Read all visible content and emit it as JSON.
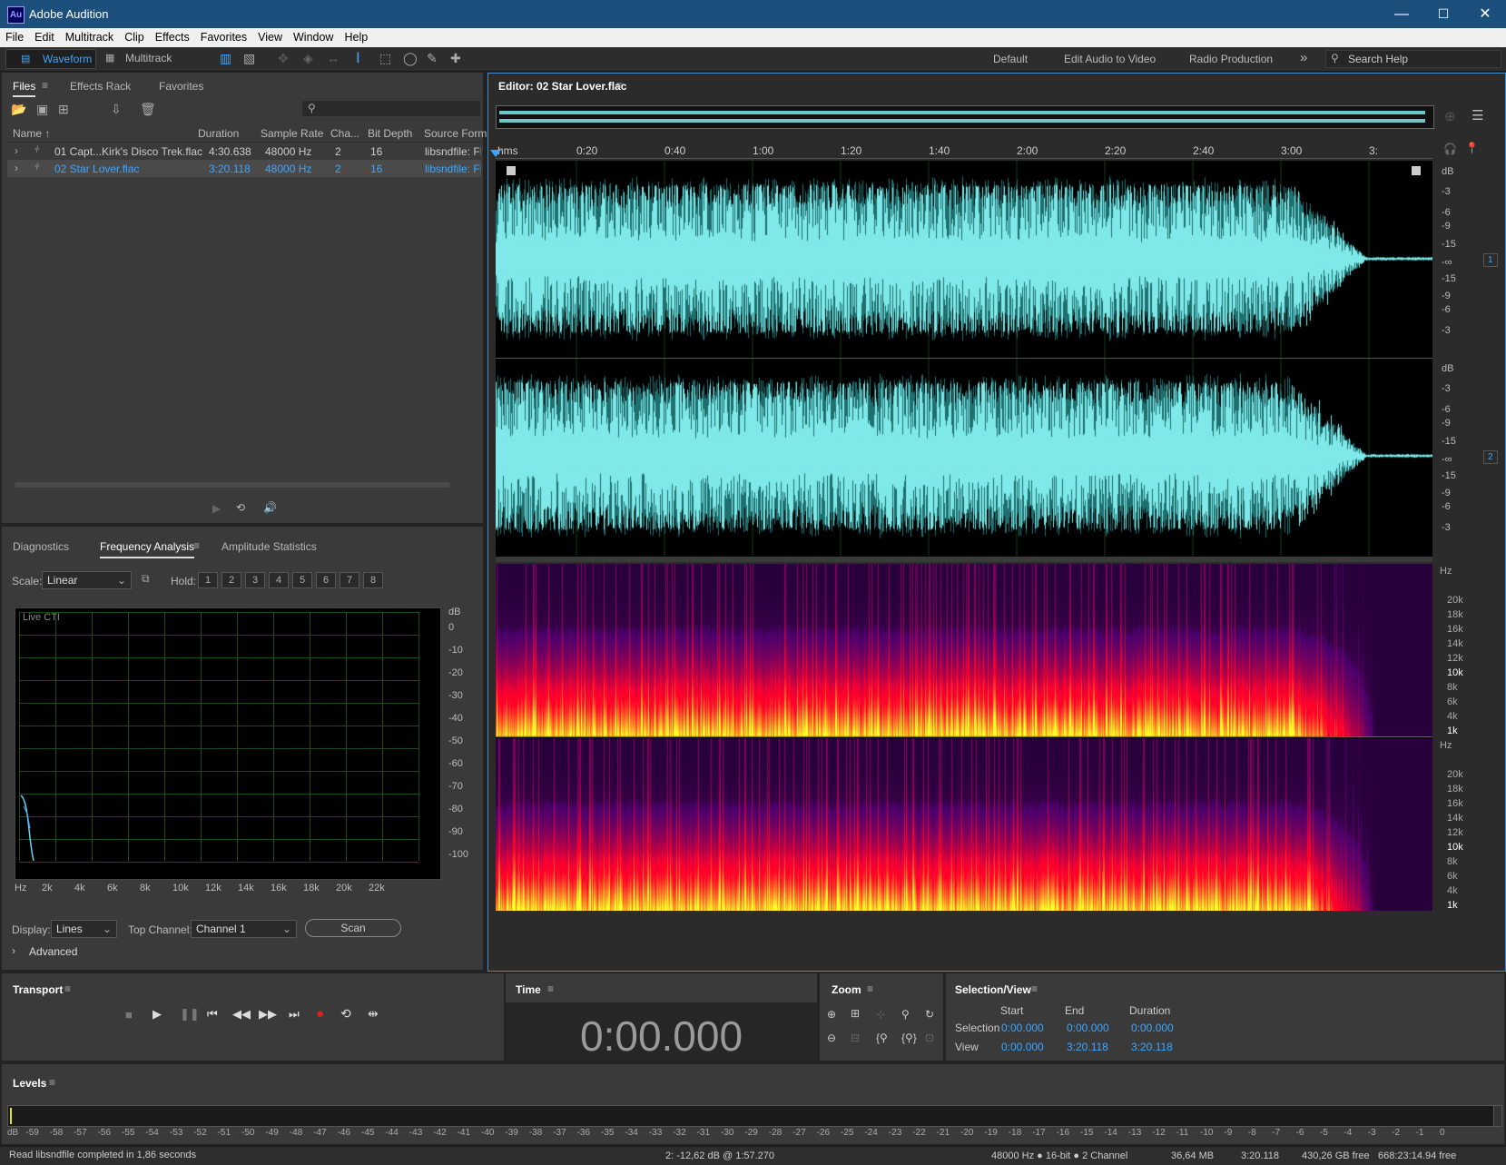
{
  "window": {
    "title": "Adobe Audition",
    "logo": "Au",
    "controls": [
      "—",
      "☐",
      "✕"
    ]
  },
  "menu": [
    "File",
    "Edit",
    "Multitrack",
    "Clip",
    "Effects",
    "Favorites",
    "View",
    "Window",
    "Help"
  ],
  "toolbar": {
    "waveform": "Waveform",
    "multitrack": "Multitrack",
    "workspaces": [
      "Default",
      "Edit Audio to Video",
      "Radio Production"
    ],
    "more": "»",
    "search_placeholder": "Search Help"
  },
  "files_panel": {
    "tabs": [
      "Files",
      "Effects Rack",
      "Favorites"
    ],
    "columns": [
      "Name",
      "Duration",
      "Sample Rate",
      "Cha...",
      "Bit Depth",
      "Source Forma"
    ],
    "rows": [
      {
        "name": "01 Capt...Kirk's Disco Trek.flac",
        "duration": "4:30.638",
        "rate": "48000 Hz",
        "ch": "2",
        "depth": "16",
        "format": "libsndfile: FL",
        "selected": false
      },
      {
        "name": "02 Star Lover.flac",
        "duration": "3:20.118",
        "rate": "48000 Hz",
        "ch": "2",
        "depth": "16",
        "format": "libsndfile: FL",
        "selected": true
      }
    ]
  },
  "freq_panel": {
    "tabs": [
      "Diagnostics",
      "Frequency Analysis",
      "Amplitude Statistics"
    ],
    "scale_label": "Scale:",
    "scale_value": "Linear",
    "hold_label": "Hold:",
    "holds": [
      "1",
      "2",
      "3",
      "4",
      "5",
      "6",
      "7",
      "8"
    ],
    "hold_colors": [
      "#e02020",
      "#ff8c00",
      "#e6e600",
      "#7fd000",
      "#20c040",
      "#00c8d8",
      "#3a7fff",
      "#e020e0"
    ],
    "graph_label": "Live CTI",
    "db_ticks": [
      "dB",
      "0",
      "-10",
      "-20",
      "-30",
      "-40",
      "-50",
      "-60",
      "-70",
      "-80",
      "-90",
      "-100"
    ],
    "hz_ticks": [
      "Hz",
      "2k",
      "4k",
      "6k",
      "8k",
      "10k",
      "12k",
      "14k",
      "16k",
      "18k",
      "20k",
      "22k"
    ],
    "display_label": "Display:",
    "display_value": "Lines",
    "top_channel_label": "Top Channel:",
    "top_channel_value": "Channel 1",
    "scan": "Scan",
    "advanced": "Advanced"
  },
  "editor": {
    "title": "Editor: 02 Star Lover.flac",
    "ruler": [
      "hms",
      "0:20",
      "0:40",
      "1:00",
      "1:20",
      "1:40",
      "2:00",
      "2:20",
      "2:40",
      "3:00",
      "3:"
    ],
    "db_scale": [
      "dB",
      "-3",
      "-6",
      "-9",
      "-15",
      "-∞",
      "-15",
      "-9",
      "-6",
      "-3"
    ],
    "channels": [
      "1",
      "2"
    ],
    "hz_scale": [
      "Hz",
      "20k",
      "18k",
      "16k",
      "14k",
      "12k",
      "10k",
      "8k",
      "6k",
      "4k",
      "1k"
    ]
  },
  "transport": {
    "title": "Transport"
  },
  "time": {
    "title": "Time",
    "value": "0:00.000"
  },
  "zoom": {
    "title": "Zoom"
  },
  "selection": {
    "title": "Selection/View",
    "headers": [
      "Start",
      "End",
      "Duration"
    ],
    "rows": [
      {
        "label": "Selection",
        "start": "0:00.000",
        "end": "0:00.000",
        "duration": "0:00.000"
      },
      {
        "label": "View",
        "start": "0:00.000",
        "end": "3:20.118",
        "duration": "3:20.118"
      }
    ]
  },
  "levels": {
    "title": "Levels",
    "ticks": [
      "dB",
      "-59",
      "-58",
      "-57",
      "-56",
      "-55",
      "-54",
      "-53",
      "-52",
      "-51",
      "-50",
      "-49",
      "-48",
      "-47",
      "-46",
      "-45",
      "-44",
      "-43",
      "-42",
      "-41",
      "-40",
      "-39",
      "-38",
      "-37",
      "-36",
      "-35",
      "-34",
      "-33",
      "-32",
      "-31",
      "-30",
      "-29",
      "-28",
      "-27",
      "-26",
      "-25",
      "-24",
      "-23",
      "-22",
      "-21",
      "-20",
      "-19",
      "-18",
      "-17",
      "-16",
      "-15",
      "-14",
      "-13",
      "-12",
      "-11",
      "-10",
      "-9",
      "-8",
      "-7",
      "-6",
      "-5",
      "-4",
      "-3",
      "-2",
      "-1",
      "0"
    ]
  },
  "status": {
    "message": "Read libsndfile completed in 1,86 seconds",
    "cursor": "2: -12,62 dB @ 1:57.270",
    "format": "48000 Hz ● 16-bit ● 2 Channel",
    "size": "36,64 MB",
    "duration": "3:20.118",
    "free": "430,26 GB free",
    "free_time": "668:23:14.94 free"
  },
  "colors": {
    "waveform": "#7fe8e8",
    "selection_blue": "#3ea6ff",
    "panel": "#3a3a3a"
  }
}
